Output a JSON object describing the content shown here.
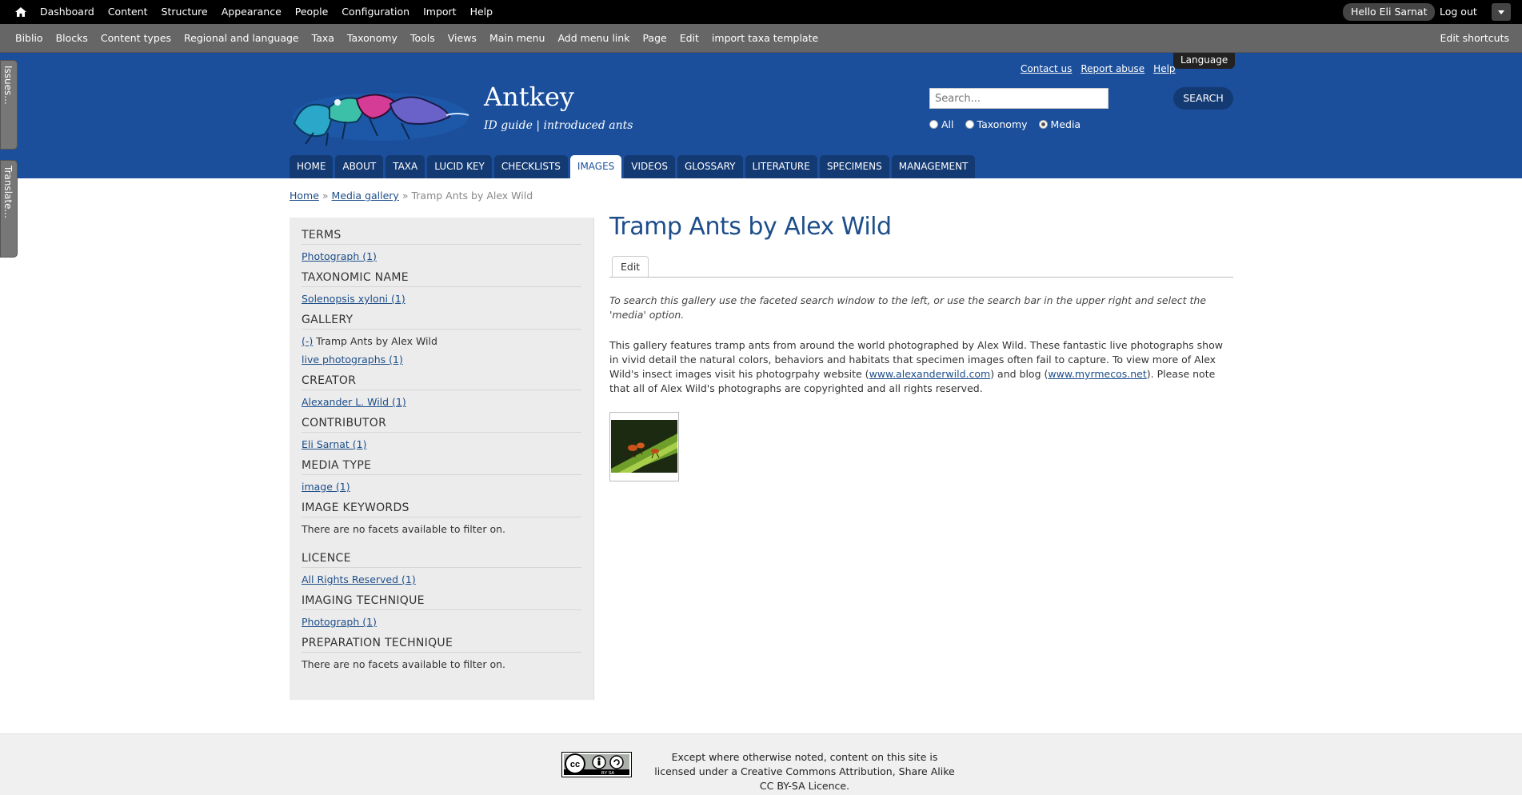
{
  "admin_toolbar": {
    "menu": [
      "Dashboard",
      "Content",
      "Structure",
      "Appearance",
      "People",
      "Configuration",
      "Import",
      "Help"
    ],
    "user": "Hello Eli Sarnat",
    "logout": "Log out"
  },
  "shortcuts": {
    "items": [
      "Biblio",
      "Blocks",
      "Content types",
      "Regional and language",
      "Taxa",
      "Taxonomy",
      "Tools",
      "Views",
      "Main menu",
      "Add menu link",
      "Page",
      "Edit",
      "import taxa template"
    ],
    "edit": "Edit shortcuts"
  },
  "side_tabs": [
    "Issues...",
    "Translate..."
  ],
  "header": {
    "site_name": "Antkey",
    "slogan": "ID guide | introduced ants",
    "top_links": [
      "Contact us",
      "Report abuse",
      "Help"
    ],
    "language": "Language",
    "search": {
      "placeholder": "Search...",
      "button": "SEARCH",
      "options": [
        "All",
        "Taxonomy",
        "Media"
      ],
      "selected": "Media"
    }
  },
  "nav": {
    "tabs": [
      "HOME",
      "ABOUT",
      "TAXA",
      "LUCID KEY",
      "CHECKLISTS",
      "IMAGES",
      "VIDEOS",
      "GLOSSARY",
      "LITERATURE",
      "SPECIMENS",
      "MANAGEMENT"
    ],
    "active": "IMAGES"
  },
  "breadcrumb": {
    "home": "Home",
    "sep": "»",
    "gallery": "Media gallery",
    "current": "Tramp Ants by Alex Wild"
  },
  "facets": {
    "terms": {
      "heading": "TERMS",
      "item": "Photograph (1)"
    },
    "taxonomic_name": {
      "heading": "TAXONOMIC NAME",
      "item": "Solenopsis xyloni (1)"
    },
    "gallery": {
      "heading": "GALLERY",
      "remove": "(-)",
      "selected": "Tramp Ants by Alex Wild",
      "item": "live photographs (1)"
    },
    "creator": {
      "heading": "CREATOR",
      "item": "Alexander L. Wild (1)"
    },
    "contributor": {
      "heading": "CONTRIBUTOR",
      "item": "Eli Sarnat (1)"
    },
    "media_type": {
      "heading": "MEDIA TYPE",
      "item": "image (1)"
    },
    "image_keywords": {
      "heading": "IMAGE KEYWORDS",
      "empty": "There are no facets available to filter on."
    },
    "licence": {
      "heading": "LICENCE",
      "item": "All Rights Reserved (1)"
    },
    "imaging_technique": {
      "heading": "IMAGING TECHNIQUE",
      "item": "Photograph (1)"
    },
    "preparation_technique": {
      "heading": "PREPARATION TECHNIQUE",
      "empty": "There are no facets available to filter on."
    }
  },
  "content": {
    "title": "Tramp Ants by Alex Wild",
    "edit_tab": "Edit",
    "intro": "To search this gallery use the faceted search window to the left, or use the search bar in the upper right and select the 'media' option.",
    "desc_1": "This gallery features tramp ants from around the world photographed by Alex Wild. These fantastic live photographs show in vivid detail the natural colors, behaviors and habitats that specimen images  often fail to capture. To view more of Alex Wild's insect images visit his photogrpahy website (",
    "link_1": "www.alexanderwild.com",
    "desc_2": ") and blog (",
    "link_2": "www.myrmecos.net",
    "desc_3": "). Please note that all of Alex Wild's photographs are copyrighted and all rights reserved."
  },
  "footer": {
    "licence": "Except where otherwise noted, content on this site is licensed under a Creative Commons Attribution, Share Alike CC BY-SA Licence.",
    "badge_text": "BY  SA"
  },
  "colors": {
    "header_blue": "#1b4f9c",
    "nav_dark": "#143a73",
    "link": "#1d4e8a"
  }
}
